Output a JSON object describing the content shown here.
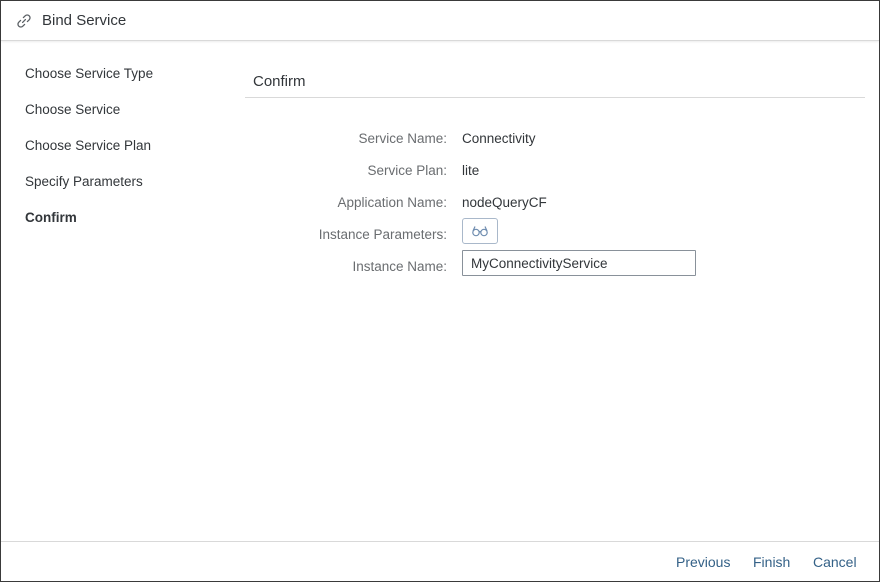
{
  "dialog": {
    "title": "Bind Service",
    "title_icon": "link-icon"
  },
  "steps": [
    {
      "label": "Choose Service Type",
      "active": false
    },
    {
      "label": "Choose Service",
      "active": false
    },
    {
      "label": "Choose Service Plan",
      "active": false
    },
    {
      "label": "Specify Parameters",
      "active": false
    },
    {
      "label": "Confirm",
      "active": true
    }
  ],
  "confirm": {
    "section_title": "Confirm",
    "fields": {
      "service_name": {
        "label": "Service Name:",
        "value": "Connectivity"
      },
      "service_plan": {
        "label": "Service Plan:",
        "value": "lite"
      },
      "application_name": {
        "label": "Application Name:",
        "value": "nodeQueryCF"
      },
      "instance_parameters": {
        "label": "Instance Parameters:",
        "icon": "glasses-icon"
      },
      "instance_name": {
        "label": "Instance Name:",
        "value": "MyConnectivityService"
      }
    }
  },
  "footer": {
    "previous_label": "Previous",
    "finish_label": "Finish",
    "cancel_label": "Cancel"
  },
  "colors": {
    "link_text": "#346187",
    "label_text": "#6a6d70",
    "primary_text": "#32363a",
    "divider": "#d9d9d9"
  }
}
